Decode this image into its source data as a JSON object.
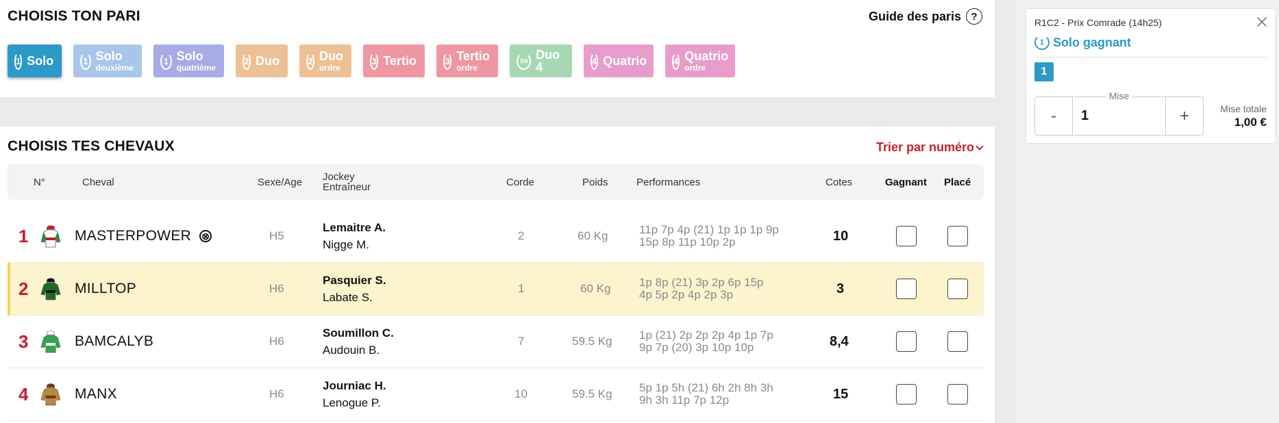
{
  "pari": {
    "title": "CHOISIS TON PARI",
    "guide_label": "Guide des paris",
    "help_icon": "?",
    "bet_types": [
      {
        "num": "1",
        "label": "Solo",
        "sub": "",
        "color": "#2c9ac8",
        "active": true
      },
      {
        "num": "1",
        "label": "Solo",
        "sub": "deuxième",
        "color": "#a9c6ea",
        "active": false
      },
      {
        "num": "1",
        "label": "Solo",
        "sub": "quatrième",
        "color": "#a7abe6",
        "active": false
      },
      {
        "num": "2",
        "label": "Duo",
        "sub": "",
        "color": "#eec096",
        "active": false
      },
      {
        "num": "2",
        "label": "Duo",
        "sub": "ordre",
        "color": "#eec096",
        "active": false
      },
      {
        "num": "3",
        "label": "Tertio",
        "sub": "",
        "color": "#ee97a3",
        "active": false
      },
      {
        "num": "3",
        "label": "Tertio",
        "sub": "ordre",
        "color": "#ee97a3",
        "active": false
      },
      {
        "num": "2/4",
        "label": "Duo 4",
        "sub": "",
        "color": "#a6d8b4",
        "active": false
      },
      {
        "num": "4",
        "label": "Quatrio",
        "sub": "",
        "color": "#e89ccc",
        "active": false
      },
      {
        "num": "4",
        "label": "Quatrio",
        "sub": "ordre",
        "color": "#e89ccc",
        "active": false
      }
    ]
  },
  "horses": {
    "title": "CHOISIS TES CHEVAUX",
    "sort_label": "Trier par numéro",
    "columns": {
      "num": "N°",
      "cheval": "Cheval",
      "sexe_age": "Sexe/Age",
      "jockey": "Jockey",
      "entraineur": "Entraîneur",
      "corde": "Corde",
      "poids": "Poids",
      "performances": "Performances",
      "cotes": "Cotes",
      "gagnant": "Gagnant",
      "place": "Placé"
    },
    "rows": [
      {
        "num": "1",
        "name": "MASTERPOWER",
        "nonrunner_icon": "⊗",
        "sexe_age": "H5",
        "jockey": "Lemaitre A.",
        "trainer": "Nigge M.",
        "corde": "2",
        "poids": "60 Kg",
        "perf1": "11p 7p 4p (21) 1p 1p 1p 9p",
        "perf2": "15p 8p 11p 10p 2p",
        "odds": "10",
        "silk": {
          "body": "#ffffff",
          "band": "#d0192b",
          "sleeve": "#2f8f3a",
          "cap": "#d0192b"
        }
      },
      {
        "num": "2",
        "name": "MILLTOP",
        "nonrunner_icon": "",
        "sexe_age": "H6",
        "jockey": "Pasquier S.",
        "trainer": "Labate S.",
        "corde": "1",
        "poids": "60 Kg",
        "perf1": "1p 8p (21) 3p 2p 6p 15p",
        "perf2": "4p 5p 2p 4p 2p 3p",
        "odds": "3",
        "silk": {
          "body": "#1c6b2c",
          "band": "#111111",
          "sleeve": "#1c6b2c",
          "cap": "#111111"
        }
      },
      {
        "num": "3",
        "name": "BAMCALYB",
        "nonrunner_icon": "",
        "sexe_age": "H6",
        "jockey": "Soumillon C.",
        "trainer": "Audouin B.",
        "corde": "7",
        "poids": "59.5 Kg",
        "perf1": "1p (21) 2p 2p 2p 4p 1p 7p",
        "perf2": "9p 7p (20) 3p 10p 10p",
        "odds": "8,4",
        "silk": {
          "body": "#2fa84a",
          "band": "#ffffff",
          "sleeve": "#2fa84a",
          "cap": "#ffffff"
        }
      },
      {
        "num": "4",
        "name": "MANX",
        "nonrunner_icon": "",
        "sexe_age": "H6",
        "jockey": "Journiac H.",
        "trainer": "Lenogue P.",
        "corde": "10",
        "poids": "59.5 Kg",
        "perf1": "5p 1p 5h (21) 6h 2h 8h 3h",
        "perf2": "9h 3h 11p 7p 12p",
        "odds": "15",
        "silk": {
          "body": "#b88a3c",
          "band": "#6a3d1a",
          "sleeve": "#b88a3c",
          "cap": "#6a3d1a"
        }
      }
    ]
  },
  "ticket": {
    "race": "R1C2 - Prix Comrade (14h25)",
    "bet_num": "1",
    "bet_type": "Solo gagnant",
    "selection": "1",
    "stake_label": "Mise",
    "stake_value": "1",
    "minus": "-",
    "plus": "+",
    "total_label": "Mise totale",
    "total_value": "1,00 €"
  }
}
